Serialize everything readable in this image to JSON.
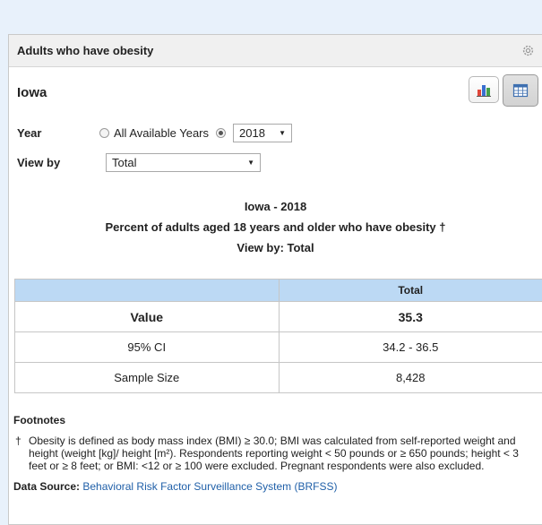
{
  "widget": {
    "title": "Adults who have obesity",
    "location": "Iowa"
  },
  "filters": {
    "year_label": "Year",
    "all_years_label": "All Available Years",
    "year_value": "2018",
    "viewby_label": "View by",
    "viewby_value": "Total"
  },
  "titles": {
    "line1": "Iowa - 2018",
    "line2": "Percent of adults aged 18 years and older who have obesity †",
    "line3": "View by: Total"
  },
  "table": {
    "header": [
      "",
      "Total"
    ],
    "rows": [
      {
        "label": "Value",
        "value": "35.3"
      },
      {
        "label": "95% CI",
        "value": "34.2 - 36.5"
      },
      {
        "label": "Sample Size",
        "value": "8,428"
      }
    ]
  },
  "footnotes": {
    "title": "Footnotes",
    "dagger": "†",
    "text": "Obesity is defined as body mass index (BMI) ≥ 30.0; BMI was calculated from self-reported weight and height (weight [kg]/ height [m²). Respondents reporting weight < 50 pounds or ≥ 650 pounds; height < 3 feet or ≥ 8 feet; or BMI: <12 or ≥ 100 were excluded. Pregnant respondents were also excluded.",
    "source_label": "Data Source:",
    "source_link": "Behavioral Risk Factor Surveillance System (BRFSS)"
  },
  "colors": {
    "page_bg": "#e8f1fb",
    "table_header": "#bcd9f4",
    "link": "#1f5fa8"
  },
  "icons": [
    "gear-icon",
    "bar-chart-icon",
    "table-icon"
  ]
}
